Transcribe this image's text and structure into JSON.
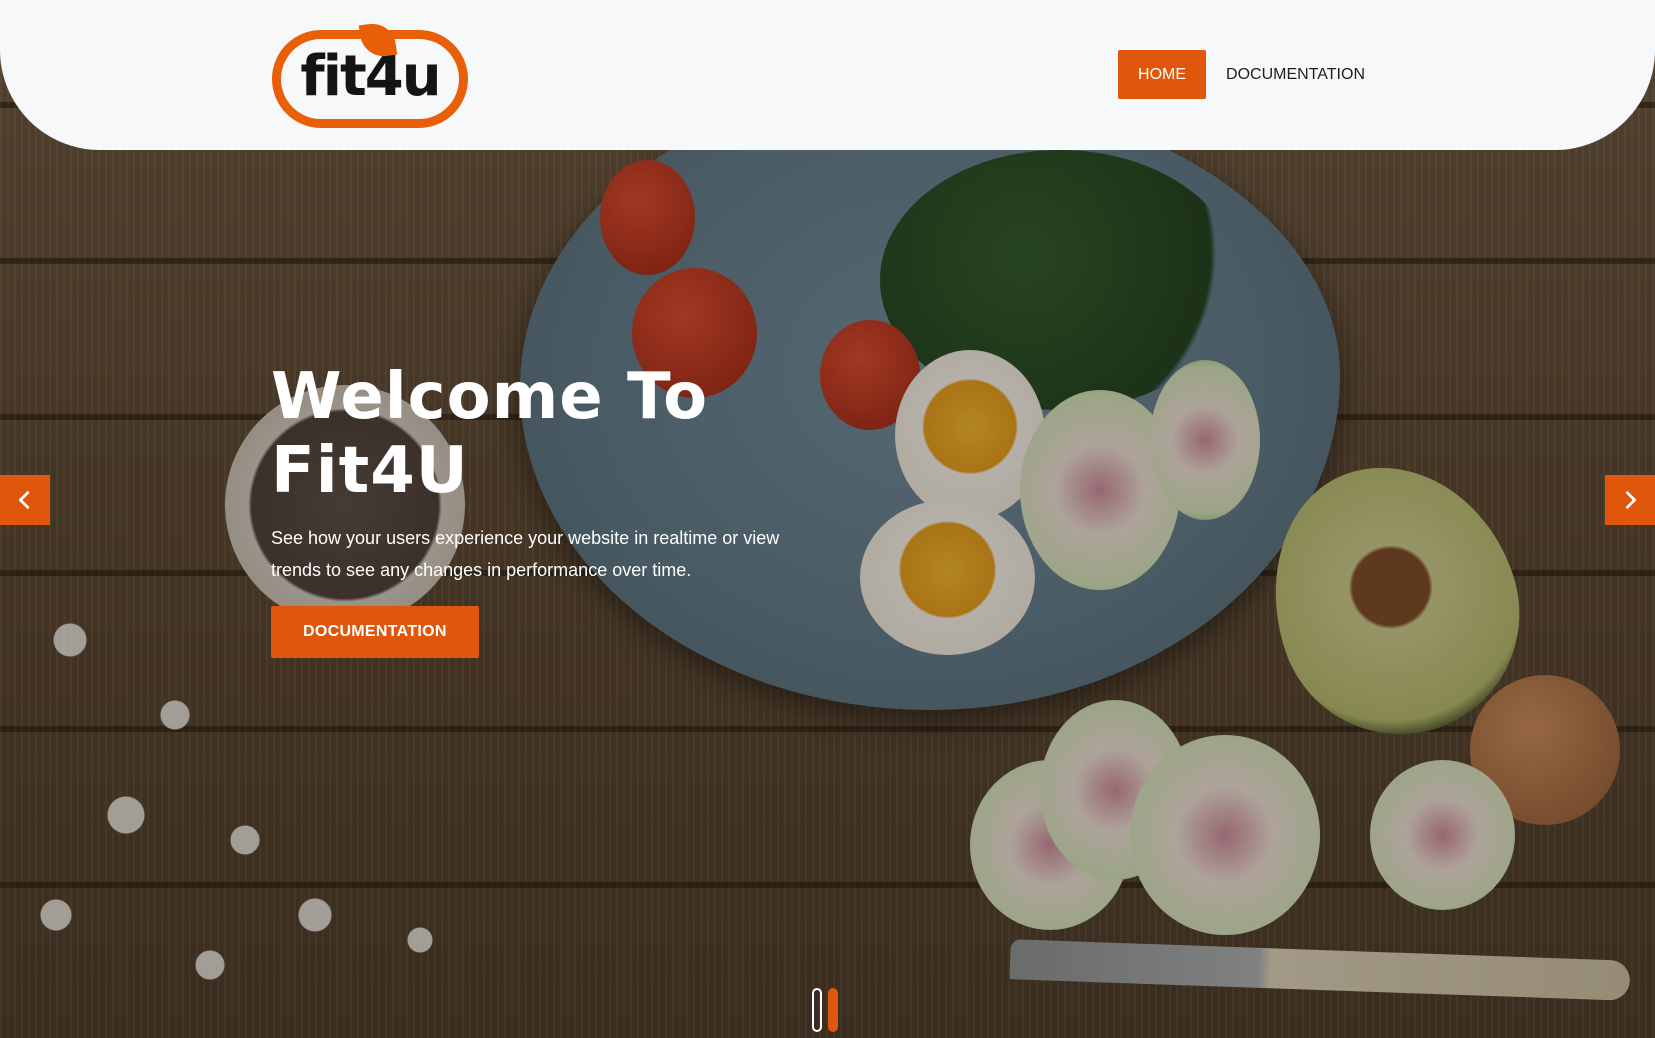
{
  "brand": {
    "logo_text": "fit4u",
    "accent_color": "#e0560a"
  },
  "nav": {
    "items": [
      {
        "label": "HOME",
        "active": true
      },
      {
        "label": "DOCUMENTATION",
        "active": false
      }
    ]
  },
  "hero": {
    "title_line1": "Welcome To",
    "title_line2": "Fit4U",
    "subtitle": "See how your users experience your website in realtime or view trends to see any changes in performance over time.",
    "cta_label": "DOCUMENTATION"
  },
  "carousel": {
    "prev_icon": "chevron-left-icon",
    "next_icon": "chevron-right-icon",
    "slide_count": 2,
    "active_index": 1
  }
}
